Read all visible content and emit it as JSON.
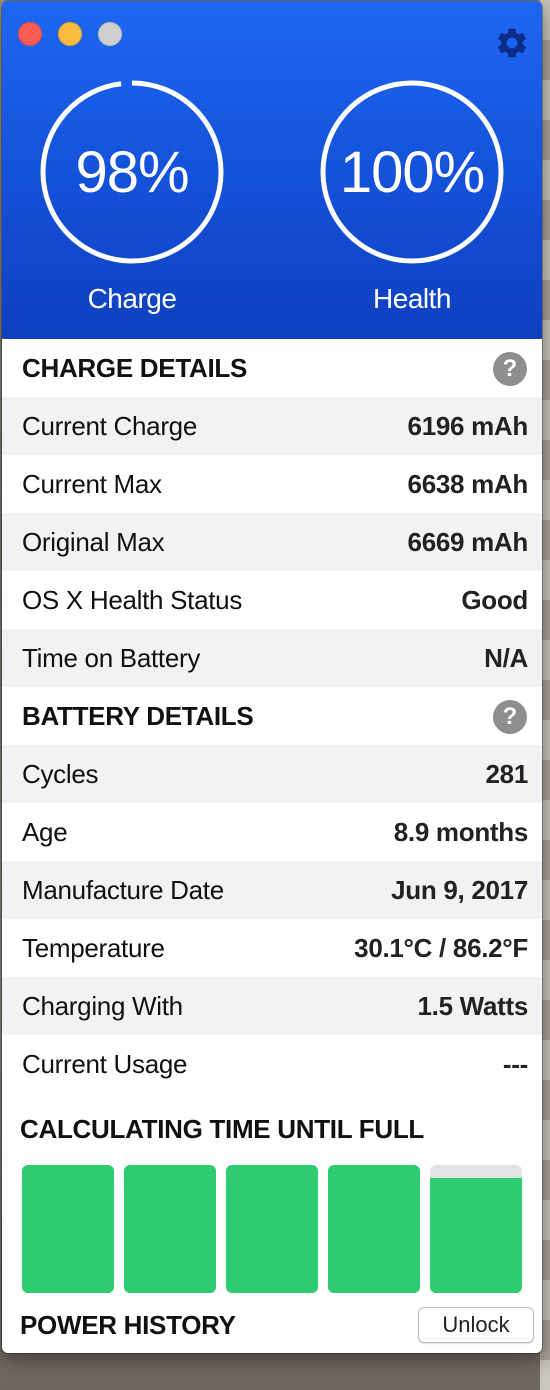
{
  "header": {
    "charge": {
      "value_text": "98%",
      "label": "Charge",
      "fraction": 0.98
    },
    "health": {
      "value_text": "100%",
      "label": "Health",
      "fraction": 1.0
    }
  },
  "charge_details": {
    "title": "CHARGE DETAILS",
    "help": "?",
    "rows": [
      {
        "label": "Current Charge",
        "value": "6196 mAh"
      },
      {
        "label": "Current Max",
        "value": "6638 mAh"
      },
      {
        "label": "Original Max",
        "value": "6669 mAh"
      },
      {
        "label": "OS X Health Status",
        "value": "Good"
      },
      {
        "label": "Time on Battery",
        "value": "N/A"
      }
    ]
  },
  "battery_details": {
    "title": "BATTERY DETAILS",
    "help": "?",
    "rows": [
      {
        "label": "Cycles",
        "value": "281"
      },
      {
        "label": "Age",
        "value": "8.9 months"
      },
      {
        "label": "Manufacture Date",
        "value": "Jun 9, 2017"
      },
      {
        "label": "Temperature",
        "value": "30.1°C / 86.2°F"
      },
      {
        "label": "Charging With",
        "value": "1.5 Watts"
      },
      {
        "label": "Current Usage",
        "value": "---"
      }
    ]
  },
  "time_section": {
    "title": "CALCULATING TIME UNTIL FULL"
  },
  "battery_bars": [
    1.0,
    1.0,
    1.0,
    1.0,
    0.9
  ],
  "power_history": {
    "title": "POWER HISTORY",
    "unlock_label": "Unlock"
  },
  "colors": {
    "header_blue": "#1450d8",
    "bar_green": "#2ecc71",
    "traffic_close": "#fc5d57",
    "traffic_minimize": "#fdbc40",
    "traffic_zoom": "#cfcfcf"
  },
  "icons": {
    "settings": "gear-icon",
    "help": "question-circle-icon"
  }
}
